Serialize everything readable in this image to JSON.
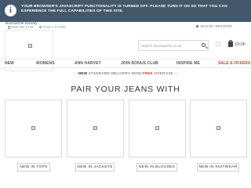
{
  "notice": {
    "icon": "info-icon",
    "text": "YOUR BROWSER'S JAVASCRIPT FUNCTIONALITY IS TURNED OFF. PLEASE TURN IT ON SO THAT YOU CAN EXPERIENCE THE FULL CAPABILITIES OF THIS SITE."
  },
  "header": {
    "cookie_note": "Bonmarché:security",
    "phone": "0330 026 2738",
    "store_finder": "FIND A STORE",
    "account": "SIGN IN / REGISTER",
    "search_placeholder": "Search Bonmarché.co.uk",
    "basket_total": "£0.00"
  },
  "nav": {
    "items": [
      "NEW",
      "WOMENS",
      "ANN HARVEY",
      "JOIN BONUS CLUB",
      "INSPIRE ME",
      "SALE & OFFERS"
    ]
  },
  "delivery": {
    "dash_left": "—",
    "new": "NEW",
    "text1": " STANDARD DELIVERY NOW ",
    "free": "FREE",
    "text2": " OVER £35 ",
    "dash_right": "—"
  },
  "section": {
    "title": "PAIR YOUR JEANS WITH"
  },
  "cards": [
    {
      "cta": "NEW IN TOPS"
    },
    {
      "cta": "NEW IN JACKETS"
    },
    {
      "cta": "NEW IN BLOUSES"
    },
    {
      "cta": "NEW IN KNITWEAR"
    }
  ],
  "colors": {
    "banner": "#45586b",
    "sale": "#d6402b"
  }
}
